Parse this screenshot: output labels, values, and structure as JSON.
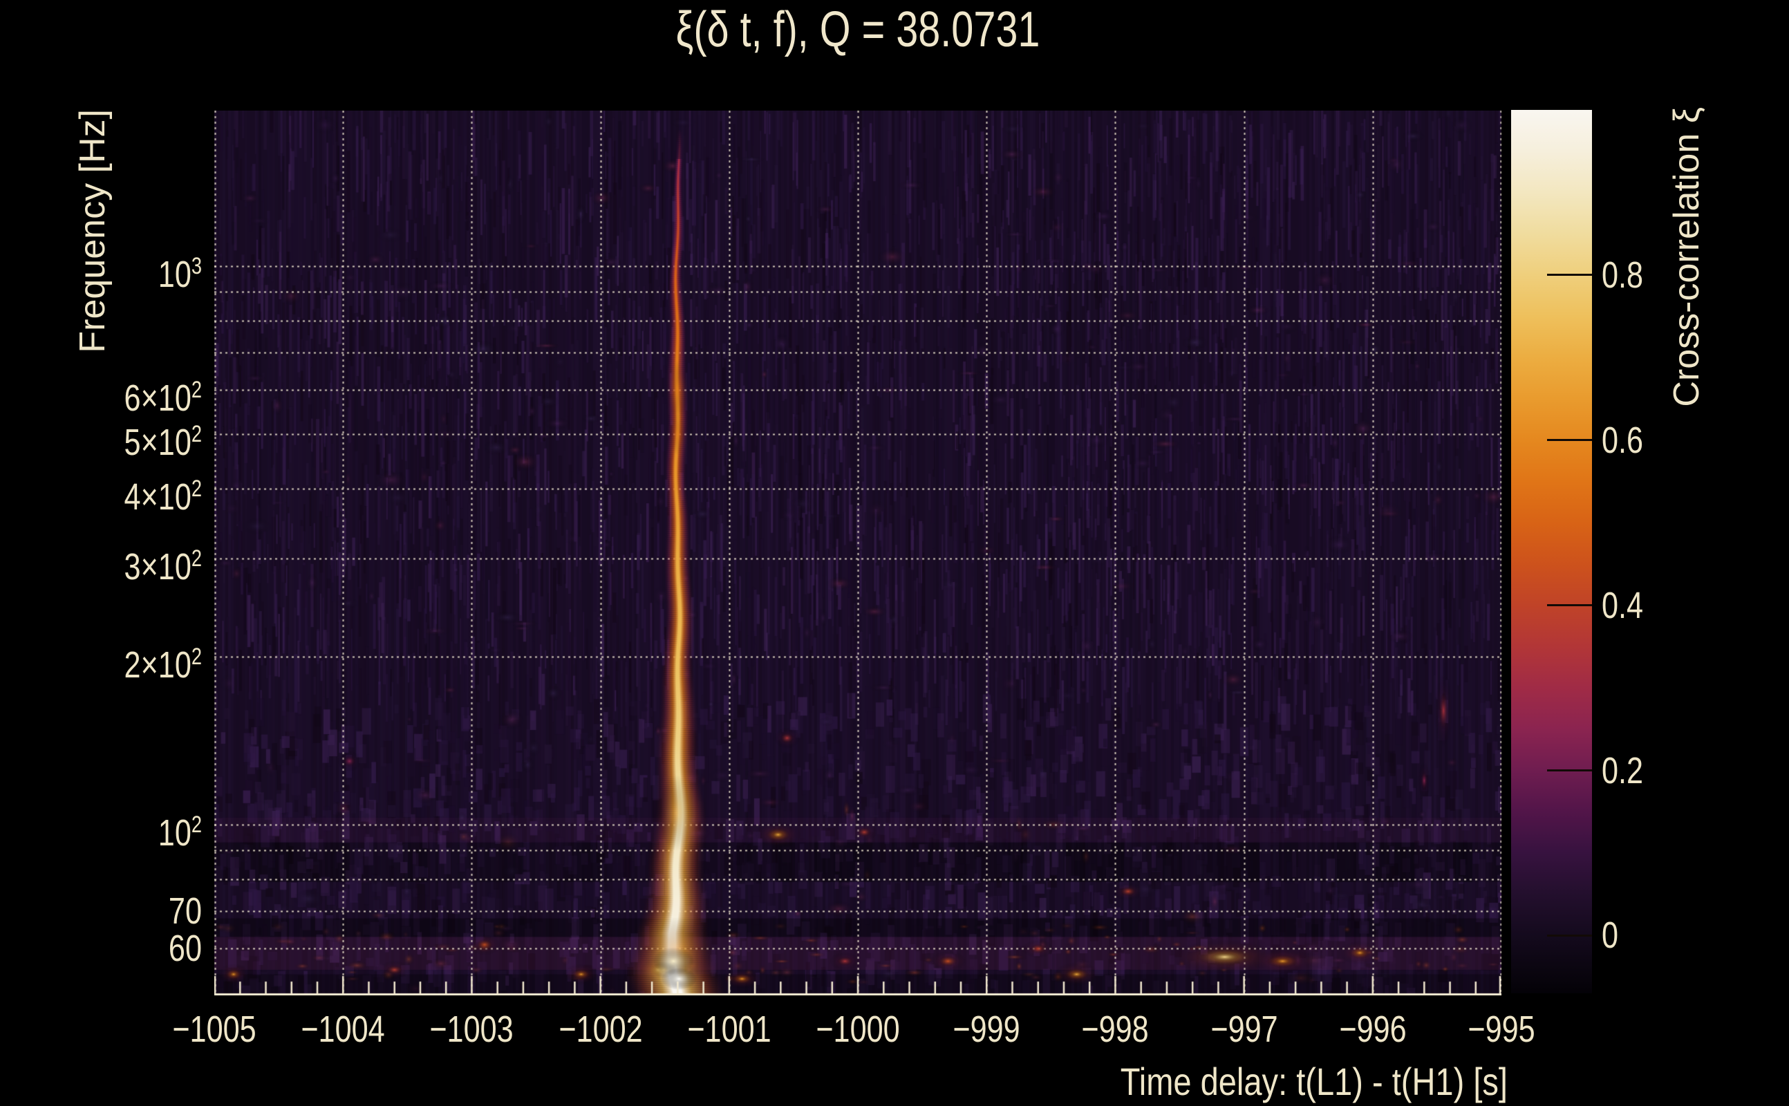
{
  "colors": {
    "background": "#000000",
    "text": "#efe6c8",
    "axis": "#f2e9d0",
    "grid": "rgba(243,234,210,0.85)",
    "plot_base": "#190c25"
  },
  "chart_data": {
    "type": "heatmap",
    "title": "ξ(δ t, f), Q = 38.0731",
    "q_value": "38.0731",
    "xlabel": "Time delay: t(L1) - t(H1) [s]",
    "ylabel": "Frequency [Hz]",
    "colorbar_label": "Cross-correlation ξ",
    "x_range": [
      -1005,
      -995
    ],
    "y_range_hz": [
      49.5,
      1900
    ],
    "y_scale": "log",
    "grid": true,
    "x_minor_step": 0.2,
    "x_ticks": [
      {
        "value": -1005,
        "label": "−1005"
      },
      {
        "value": -1004,
        "label": "−1004"
      },
      {
        "value": -1003,
        "label": "−1003"
      },
      {
        "value": -1002,
        "label": "−1002"
      },
      {
        "value": -1001,
        "label": "−1001"
      },
      {
        "value": -1000,
        "label": "−1000"
      },
      {
        "value": -999,
        "label": "−999"
      },
      {
        "value": -998,
        "label": "−998"
      },
      {
        "value": -997,
        "label": "−997"
      },
      {
        "value": -996,
        "label": "−996"
      },
      {
        "value": -995,
        "label": "−995"
      }
    ],
    "y_ticks": [
      {
        "value": 1000,
        "text": "10",
        "sup": "3"
      },
      {
        "value": 600,
        "text": "6×10",
        "sup": "2"
      },
      {
        "value": 500,
        "text": "5×10",
        "sup": "2"
      },
      {
        "value": 400,
        "text": "4×10",
        "sup": "2"
      },
      {
        "value": 300,
        "text": "3×10",
        "sup": "2"
      },
      {
        "value": 200,
        "text": "2×10",
        "sup": "2"
      },
      {
        "value": 100,
        "text": "10",
        "sup": "2"
      },
      {
        "value": 70,
        "text": "70",
        "sup": null
      },
      {
        "value": 60,
        "text": "60",
        "sup": null
      }
    ],
    "y_gridlines_hz": [
      60,
      70,
      80,
      90,
      100,
      200,
      300,
      400,
      500,
      600,
      700,
      800,
      900,
      1000
    ],
    "colorbar_range": [
      -0.07,
      1.0
    ],
    "colorbar_ticks": [
      {
        "value": 0.8,
        "label": "0.8"
      },
      {
        "value": 0.6,
        "label": "0.6"
      },
      {
        "value": 0.4,
        "label": "0.4"
      },
      {
        "value": 0.2,
        "label": "0.2"
      },
      {
        "value": 0.0,
        "label": "0"
      }
    ],
    "colormap": {
      "name": "inferno-like (dark purple → crimson → orange → sand → white)",
      "stops": [
        {
          "xi": -0.07,
          "color": "#040207"
        },
        {
          "xi": 0.0,
          "color": "#140a1d"
        },
        {
          "xi": 0.05,
          "color": "#230f2d"
        },
        {
          "xi": 0.1,
          "color": "#37123f"
        },
        {
          "xi": 0.15,
          "color": "#521549"
        },
        {
          "xi": 0.2,
          "color": "#6f1d50"
        },
        {
          "xi": 0.25,
          "color": "#8b2450"
        },
        {
          "xi": 0.3,
          "color": "#a02b46"
        },
        {
          "xi": 0.35,
          "color": "#b23637"
        },
        {
          "xi": 0.4,
          "color": "#c04328"
        },
        {
          "xi": 0.45,
          "color": "#cd521c"
        },
        {
          "xi": 0.5,
          "color": "#d86316"
        },
        {
          "xi": 0.55,
          "color": "#e07517"
        },
        {
          "xi": 0.6,
          "color": "#e5881f"
        },
        {
          "xi": 0.65,
          "color": "#e99b2e"
        },
        {
          "xi": 0.7,
          "color": "#ecad41"
        },
        {
          "xi": 0.75,
          "color": "#eec05c"
        },
        {
          "xi": 0.8,
          "color": "#efcf7c"
        },
        {
          "xi": 0.85,
          "color": "#f0dc9e"
        },
        {
          "xi": 0.9,
          "color": "#f3e7c0"
        },
        {
          "xi": 0.95,
          "color": "#f6efdc"
        },
        {
          "xi": 1.0,
          "color": "#f9f6f0"
        }
      ]
    },
    "features": {
      "main_streak": {
        "time_delay_s": -1001.4,
        "freq_span_hz": [
          52,
          1550
        ],
        "peak_xi": 1.0,
        "profile": [
          {
            "f": 1550,
            "xi": 0.3,
            "w": 2
          },
          {
            "f": 1000,
            "xi": 0.48,
            "w": 3
          },
          {
            "f": 600,
            "xi": 0.6,
            "w": 5
          },
          {
            "f": 400,
            "xi": 0.64,
            "w": 5
          },
          {
            "f": 300,
            "xi": 0.7,
            "w": 6
          },
          {
            "f": 200,
            "xi": 0.75,
            "w": 7
          },
          {
            "f": 150,
            "xi": 0.8,
            "w": 9
          },
          {
            "f": 120,
            "xi": 0.85,
            "w": 10
          },
          {
            "f": 100,
            "xi": 0.9,
            "w": 12
          },
          {
            "f": 80,
            "xi": 0.93,
            "w": 13
          },
          {
            "f": 70,
            "xi": 0.95,
            "w": 15
          },
          {
            "f": 60,
            "xi": 0.98,
            "w": 18
          },
          {
            "f": 53,
            "xi": 1.0,
            "w": 22
          }
        ]
      },
      "hotspots": [
        {
          "t": -1000.62,
          "f": 96,
          "xi": 0.55,
          "rx": 18,
          "ry": 10
        },
        {
          "t": -997.15,
          "f": 58,
          "xi": 0.68,
          "rx": 42,
          "ry": 13
        },
        {
          "t": -996.7,
          "f": 57,
          "xi": 0.5,
          "rx": 24,
          "ry": 10
        },
        {
          "t": -996.1,
          "f": 59,
          "xi": 0.5,
          "rx": 16,
          "ry": 9
        },
        {
          "t": -998.3,
          "f": 54,
          "xi": 0.55,
          "rx": 18,
          "ry": 9
        },
        {
          "t": -999.3,
          "f": 57,
          "xi": 0.45,
          "rx": 14,
          "ry": 8
        },
        {
          "t": -1002.9,
          "f": 61,
          "xi": 0.45,
          "rx": 12,
          "ry": 8
        },
        {
          "t": -1002.15,
          "f": 54,
          "xi": 0.5,
          "rx": 14,
          "ry": 8
        },
        {
          "t": -1004.85,
          "f": 54,
          "xi": 0.5,
          "rx": 12,
          "ry": 8
        },
        {
          "t": -997.9,
          "f": 76,
          "xi": 0.4,
          "rx": 12,
          "ry": 7
        },
        {
          "t": -995.45,
          "f": 160,
          "xi": 0.33,
          "rx": 7,
          "ry": 28
        },
        {
          "t": -995.6,
          "f": 120,
          "xi": 0.25,
          "rx": 5,
          "ry": 14
        },
        {
          "t": -1001.55,
          "f": 55,
          "xi": 0.72,
          "rx": 14,
          "ry": 9
        },
        {
          "t": -1000.9,
          "f": 53,
          "xi": 0.5,
          "rx": 16,
          "ry": 8
        },
        {
          "t": -998.6,
          "f": 60,
          "xi": 0.4,
          "rx": 12,
          "ry": 7
        },
        {
          "t": -1003.6,
          "f": 55,
          "xi": 0.38,
          "rx": 12,
          "ry": 7
        },
        {
          "t": -1000.1,
          "f": 57,
          "xi": 0.35,
          "rx": 12,
          "ry": 7
        },
        {
          "t": -1000.55,
          "f": 143,
          "xi": 0.35,
          "rx": 10,
          "ry": 8
        },
        {
          "t": -1003.95,
          "f": 130,
          "xi": 0.25,
          "rx": 9,
          "ry": 8
        },
        {
          "t": -999.95,
          "f": 97,
          "xi": 0.38,
          "rx": 10,
          "ry": 7
        }
      ]
    }
  }
}
